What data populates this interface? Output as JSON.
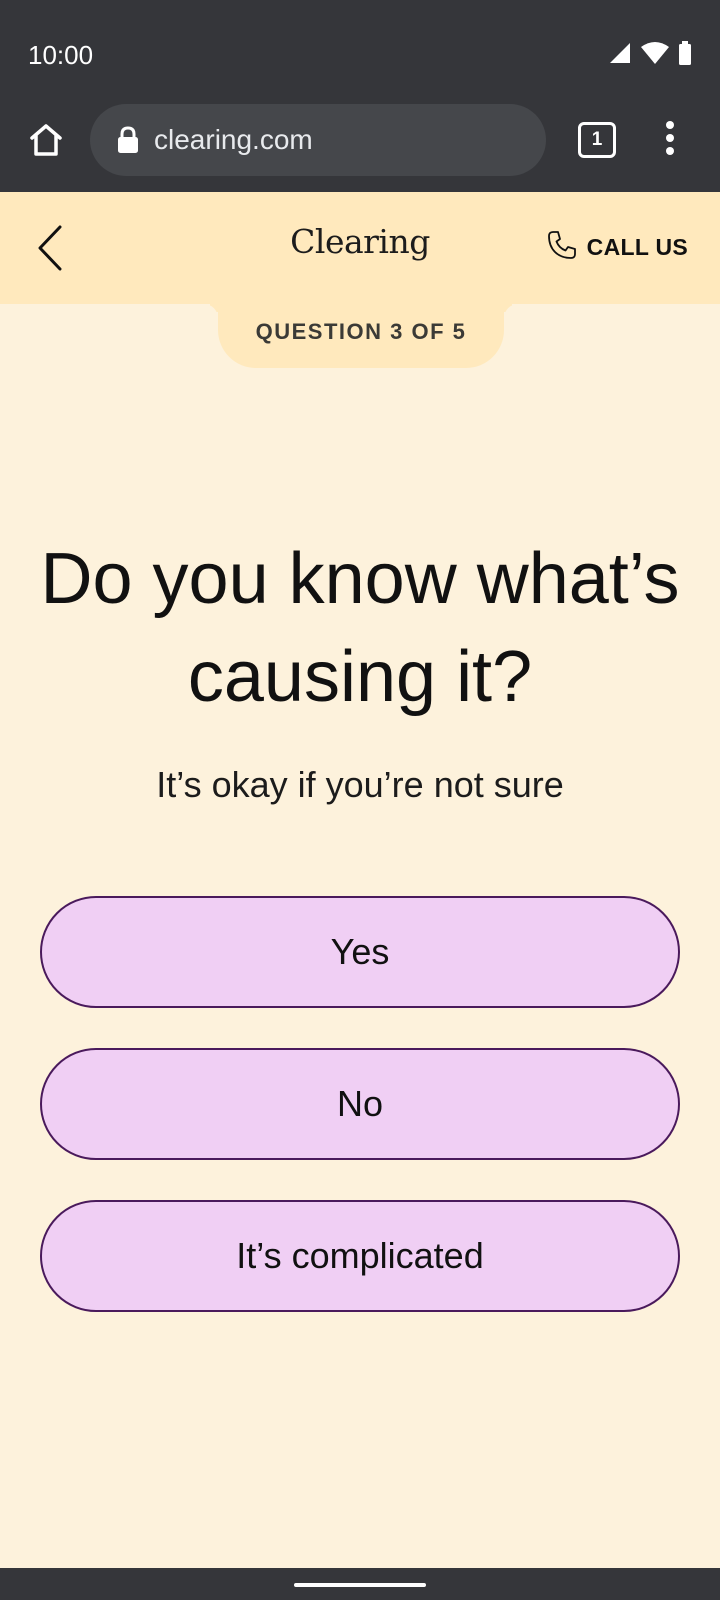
{
  "status_bar": {
    "time": "10:00",
    "icons": [
      "signal-icon",
      "wifi-icon",
      "battery-icon"
    ]
  },
  "browser": {
    "url": "clearing.com",
    "tab_count": "1",
    "icons": [
      "home-icon",
      "lock-icon",
      "tab-switcher-icon",
      "more-vert-icon"
    ]
  },
  "header": {
    "logo": "Clearing",
    "call_us": "CALL US",
    "icons": [
      "chevron-left-icon",
      "phone-icon"
    ]
  },
  "progress": {
    "label": "QUESTION 3 OF 5"
  },
  "question": {
    "title": "Do you know what’s causing it?",
    "subtitle": "It’s okay if you’re not sure"
  },
  "options": [
    {
      "label": "Yes"
    },
    {
      "label": "No"
    },
    {
      "label": "It’s complicated"
    }
  ],
  "colors": {
    "page_bg": "#fdf2dc",
    "header_bg": "#ffe9bd",
    "option_bg": "#f0cff4",
    "option_border": "#4a1a5c",
    "chrome_bg": "#35363a"
  }
}
